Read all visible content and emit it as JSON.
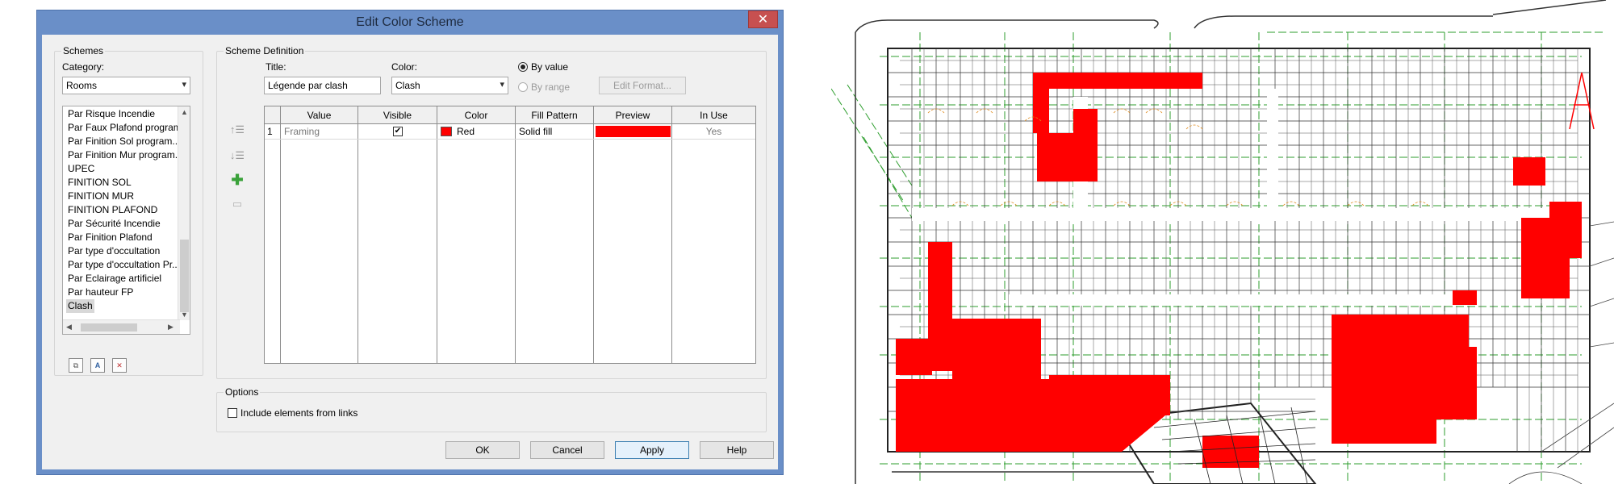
{
  "dialog": {
    "title": "Edit Color Scheme",
    "close_glyph": "✕"
  },
  "schemes": {
    "group_label": "Schemes",
    "category_label": "Category:",
    "category_value": "Rooms",
    "items": [
      "Par Risque Incendie",
      "Par Faux Plafond program",
      "Par Finition Sol program...",
      "Par Finition Mur program...",
      "UPEC",
      "FINITION SOL",
      "FINITION MUR",
      "FINITION PLAFOND",
      "Par Sécurité Incendie",
      "Par Finition Plafond",
      "Par type d'occultation",
      "Par type d'occultation Pr...",
      "Par Eclairage artificiel",
      "Par hauteur FP",
      "Clash"
    ],
    "selected": "Clash"
  },
  "definition": {
    "group_label": "Scheme Definition",
    "title_label": "Title:",
    "title_value": "Légende par clash",
    "color_label": "Color:",
    "color_value": "Clash",
    "by_value_label": "By value",
    "by_range_label": "By range",
    "edit_format_label": "Edit Format..."
  },
  "table": {
    "headers": [
      "Value",
      "Visible",
      "Color",
      "Fill Pattern",
      "Preview",
      "In Use"
    ],
    "rows": [
      {
        "index": "1",
        "value": "Framing",
        "visible": true,
        "color_name": "Red",
        "color_hex": "#ff0000",
        "fill_pattern": "Solid fill",
        "in_use": "Yes"
      }
    ]
  },
  "options": {
    "group_label": "Options",
    "include_links_label": "Include elements from links"
  },
  "buttons": {
    "ok": "OK",
    "cancel": "Cancel",
    "apply": "Apply",
    "help": "Help"
  },
  "colors": {
    "titlebar": "#6a8fc8",
    "close": "#c75050",
    "accent_red": "#ff0000",
    "dialog_bg": "#f0f0f0"
  },
  "icons": {
    "move_up": "move-up-icon",
    "move_down": "move-down-icon",
    "add": "add-icon",
    "remove": "remove-icon",
    "duplicate": "duplicate-scheme-icon",
    "rename": "rename-scheme-icon",
    "delete": "delete-scheme-icon"
  }
}
